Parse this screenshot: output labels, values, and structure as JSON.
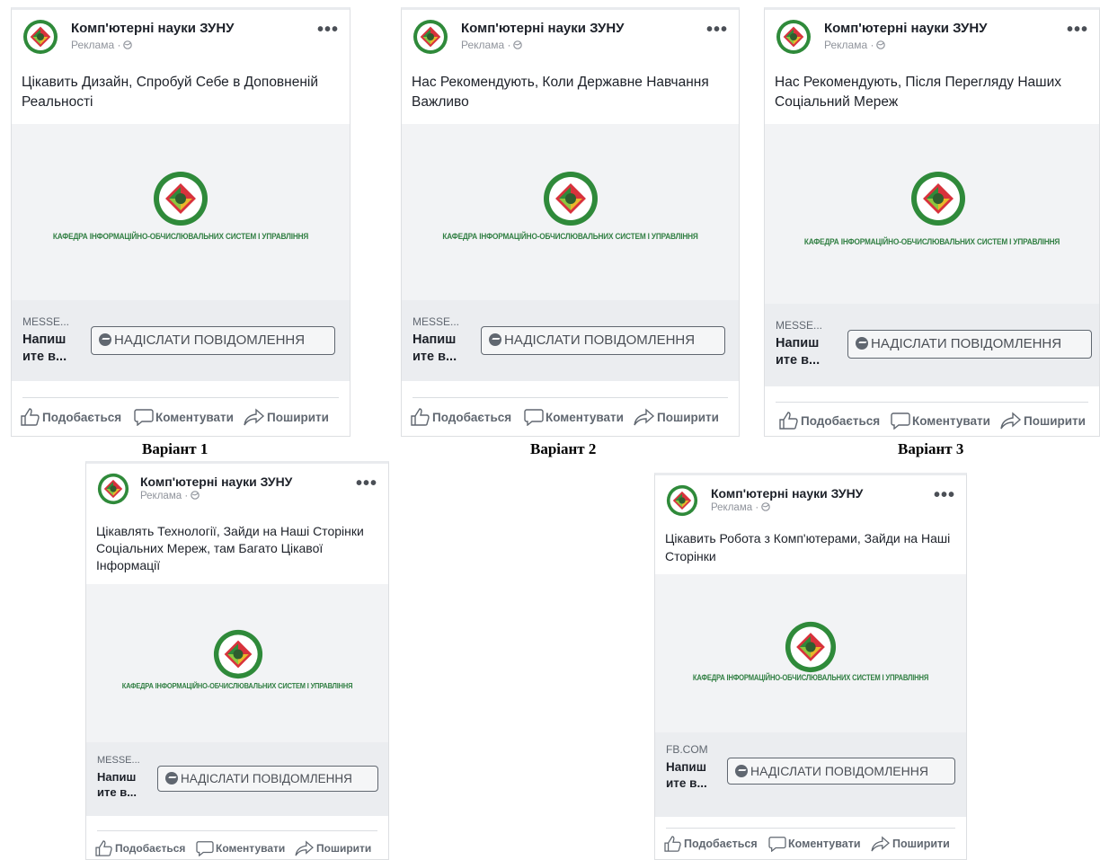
{
  "page_name": "Комп'ютерні науки ЗУНУ",
  "sponsored": "Реклама ·",
  "dept_text": "КАФЕДРА ІНФОРМАЦІЙНО-ОБЧИСЛЮВАЛЬНИХ СИСТЕМ І УПРАВЛІННЯ",
  "cta_title": "Напиш ите в...",
  "cta_button": "НАДІСЛАТИ ПОВІДОМЛЕННЯ",
  "actions": {
    "like": "Подобається",
    "comment": "Коментувати",
    "share": "Поширити"
  },
  "variants": [
    {
      "post_text": "Цікавить Дизайн, Спробуй Себе в Доповненій Реальності",
      "domain": "MESSE...",
      "caption": "Варіант 1"
    },
    {
      "post_text": "Нас Рекомендують, Коли Державне Навчання Важливо",
      "domain": "MESSE...",
      "caption": "Варіант 2"
    },
    {
      "post_text": "Нас Рекомендують, Після Перегляду Наших Соціальний Мереж",
      "domain": "MESSE...",
      "caption": "Варіант 3"
    },
    {
      "post_text": "Цікавлять Технології, Зайди на Наші Сторінки Соціальних Мереж, там Багато Цікавої Інформації",
      "domain": "MESSE...",
      "caption": ""
    },
    {
      "post_text": "Цікавить Робота з Комп'ютерами, Зайди на Наші Сторінки",
      "domain": "FB.COM",
      "caption": ""
    }
  ],
  "colors": {
    "logo_green": "#2f8a3a",
    "logo_red": "#d8323c",
    "logo_yellow": "#e9b82a",
    "logo_lime": "#8cc63f",
    "dept_green": "#317f43"
  }
}
